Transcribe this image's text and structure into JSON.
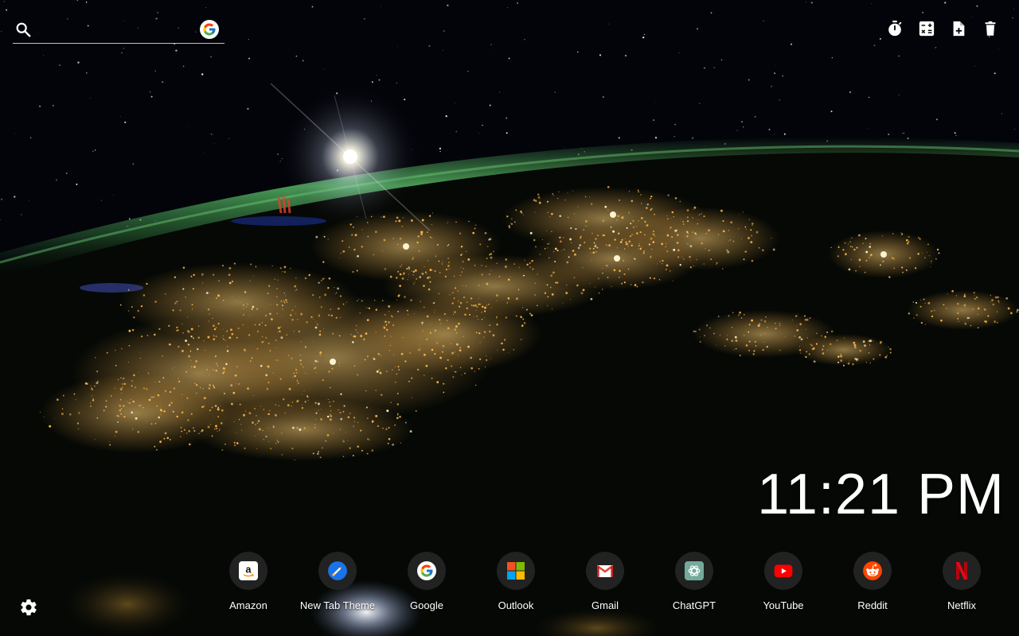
{
  "search": {
    "placeholder": "",
    "value": "",
    "engine_icon": "google-icon"
  },
  "toolbar": {
    "items": [
      {
        "icon": "timer-icon"
      },
      {
        "icon": "calculator-icon"
      },
      {
        "icon": "add-note-icon"
      },
      {
        "icon": "trash-icon"
      }
    ]
  },
  "clock": {
    "time": "11:21 PM"
  },
  "shortcuts": [
    {
      "label": "Amazon",
      "icon": "amazon-icon"
    },
    {
      "label": "New Tab Theme",
      "icon": "new-tab-theme-icon"
    },
    {
      "label": "Google",
      "icon": "google-icon"
    },
    {
      "label": "Outlook",
      "icon": "outlook-icon"
    },
    {
      "label": "Gmail",
      "icon": "gmail-icon"
    },
    {
      "label": "ChatGPT",
      "icon": "chatgpt-icon"
    },
    {
      "label": "YouTube",
      "icon": "youtube-icon"
    },
    {
      "label": "Reddit",
      "icon": "reddit-icon"
    },
    {
      "label": "Netflix",
      "icon": "netflix-icon"
    }
  ],
  "settings": {
    "icon": "gear-icon"
  },
  "colors": {
    "amazon": "#ffffff",
    "youtube": "#ff0000",
    "reddit": "#ff4500",
    "netflix": "#e50914",
    "chatgpt": "#74aa9c",
    "newtab": "#1a73e8",
    "aurora": "#5fbf6a"
  }
}
